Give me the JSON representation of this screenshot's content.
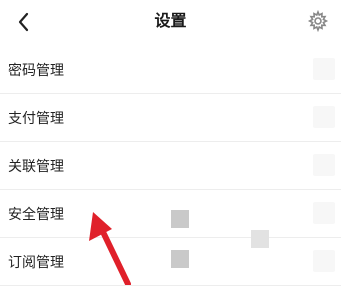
{
  "header": {
    "back_icon": "chevron-left-icon",
    "title": "设置",
    "settings_icon": "gear-icon"
  },
  "menu": {
    "items": [
      {
        "label": "密码管理"
      },
      {
        "label": "支付管理"
      },
      {
        "label": "关联管理"
      },
      {
        "label": "安全管理"
      },
      {
        "label": "订阅管理"
      }
    ]
  },
  "annotation": {
    "arrow_color": "#e0202a"
  }
}
